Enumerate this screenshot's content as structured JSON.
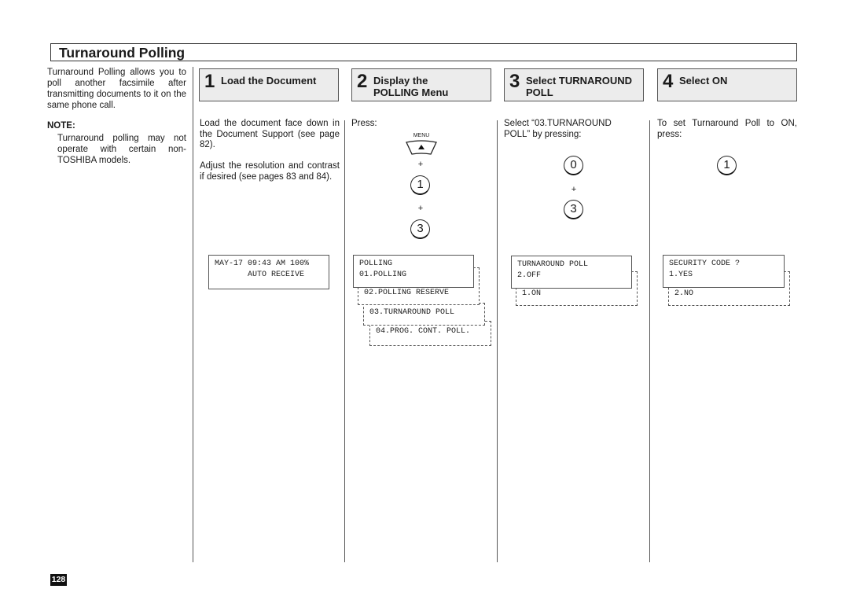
{
  "page": {
    "title": "Turnaround Polling",
    "intro": "Turnaround Polling allows you to poll another facsimile after transmitting documents to it on the same phone call.",
    "note_label": "NOTE:",
    "note_text": "Turnaround polling may not operate with certain non-TOSHIBA models.",
    "page_number": "128"
  },
  "steps": [
    {
      "number": "1",
      "title": "Load the Document",
      "paragraphs": [
        "Load the document face down in the Document Support (see page 82).",
        "Adjust the resolution and contrast if desired (see pages 83 and 84)."
      ],
      "display": {
        "lines": [
          "MAY-17 09:43 AM 100%",
          "       AUTO RECEIVE"
        ]
      }
    },
    {
      "number": "2",
      "title": "Display the POLLING Menu",
      "instruction": "Press:",
      "keys": {
        "menu_label": "MENU",
        "menu_glyph": "▲",
        "plus": "+",
        "key1": "1",
        "key2": "3"
      },
      "display": {
        "lines": [
          "POLLING",
          "01.POLLING"
        ],
        "options": [
          "02.POLLING RESERVE",
          "03.TURNAROUND POLL",
          "04.PROG. CONT. POLL."
        ]
      }
    },
    {
      "number": "3",
      "title": "Select TURNAROUND POLL",
      "instruction": "Select “03.TURNAROUND POLL” by pressing:",
      "keys": {
        "key1": "0",
        "plus": "+",
        "key2": "3"
      },
      "display": {
        "lines": [
          "TURNAROUND POLL",
          "2.OFF"
        ],
        "options": [
          "1.ON"
        ]
      }
    },
    {
      "number": "4",
      "title": "Select ON",
      "instruction": "To set Turnaround Poll to ON, press:",
      "keys": {
        "key1": "1"
      },
      "display": {
        "lines": [
          "SECURITY CODE ?",
          "1.YES"
        ],
        "options": [
          "2.NO"
        ]
      }
    }
  ]
}
